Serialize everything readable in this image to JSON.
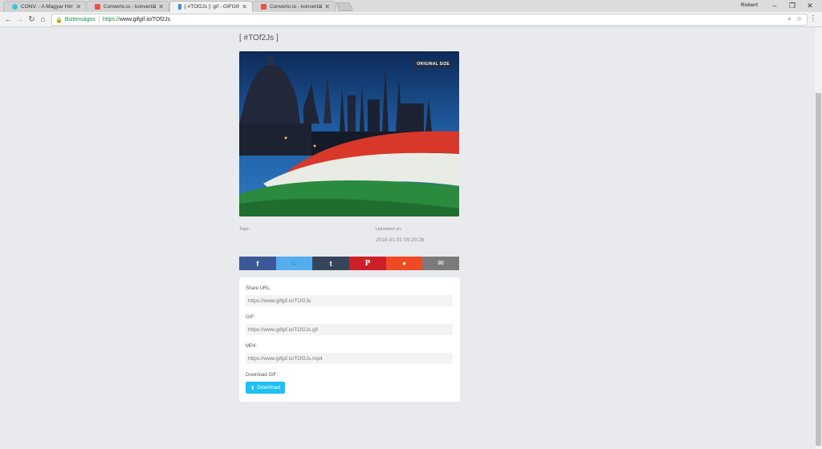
{
  "browser": {
    "tabs": [
      {
        "title": "CONV. - A Magyar Him",
        "active": false,
        "favicon_color": "#3ec7d6"
      },
      {
        "title": "Converto.io - konvertálj",
        "active": false,
        "favicon_color": "#e5534b"
      },
      {
        "title": "[ #TOf2Js ]: gif - GIFGIF.io",
        "active": true,
        "favicon_color": "#3a8fd6"
      },
      {
        "title": "Converto.io - konvertálj",
        "active": false,
        "favicon_color": "#e5534b"
      }
    ],
    "user_name": "Robert",
    "omnibox": {
      "secure_label": "Biztonságos",
      "url_protocol": "https://",
      "url_rest": "www.gifgif.io/TOf2Js"
    }
  },
  "page": {
    "title": "[ #TOf2Js ]",
    "original_size_label": "ORIGINAL SIZE",
    "tags_label": "Tags:",
    "uploaded_label": "Uploaded on:",
    "uploaded_value": "2018-01-01 09:20:26",
    "share_buttons": [
      {
        "name": "facebook",
        "glyph": "f",
        "color": "#3b5998"
      },
      {
        "name": "twitter",
        "glyph": "🐦",
        "color": "#55acee"
      },
      {
        "name": "tumblr",
        "glyph": "t",
        "color": "#35465c"
      },
      {
        "name": "pinterest",
        "glyph": "P",
        "color": "#cb2027"
      },
      {
        "name": "reddit",
        "glyph": "●",
        "color": "#ef4a23"
      },
      {
        "name": "email",
        "glyph": "✉",
        "color": "#7a7a7a"
      }
    ],
    "card": {
      "share_url_label": "Share URL:",
      "share_url_value": "https://www.gifgif.io/TOf2Js",
      "gif_label": "GIF:",
      "gif_value": "https://www.gifgif.io/TOf2Js.gif",
      "mp4_label": "MP4:",
      "mp4_value": "https://www.gifgif.io/TOf2Js.mp4",
      "download_label": "Download GIF:",
      "download_button": "Download"
    }
  }
}
